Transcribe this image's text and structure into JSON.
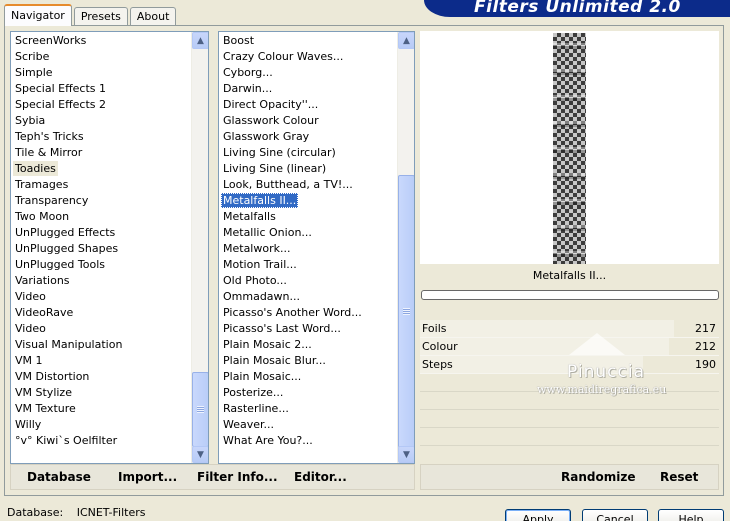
{
  "tabs": [
    {
      "label": "Navigator",
      "active": true
    },
    {
      "label": "Presets",
      "active": false
    },
    {
      "label": "About",
      "active": false
    }
  ],
  "app_title": "Filters Unlimited 2.0",
  "categories": {
    "items": [
      "ScreenWorks",
      "Scribe",
      "Simple",
      "Special Effects 1",
      "Special Effects 2",
      "Sybia",
      "Teph's Tricks",
      "Tile & Mirror",
      "Toadies",
      "Tramages",
      "Transparency",
      "Two Moon",
      "UnPlugged Effects",
      "UnPlugged Shapes",
      "UnPlugged Tools",
      "Variations",
      "Video",
      "VideoRave",
      "Video",
      "Visual Manipulation",
      "VM 1",
      "VM Distortion",
      "VM Stylize",
      "VM Texture",
      "Willy",
      "°v° Kiwi`s Oelfilter"
    ],
    "selected_index": 8,
    "scroll_position": 0.88
  },
  "filters": {
    "items": [
      "Boost",
      "Crazy Colour Waves...",
      "Cyborg...",
      "Darwin...",
      "Direct Opacity''...",
      "Glasswork Colour",
      "Glasswork Gray",
      "Living Sine (circular)",
      "Living Sine (linear)",
      "Look, Butthead, a TV!...",
      "Metalfalls II...",
      "Metalfalls",
      "Metallic Onion...",
      "Metalwork...",
      "Motion Trail...",
      "Old Photo...",
      "Ommadawn...",
      "Picasso's Another Word...",
      "Picasso's Last Word...",
      "Plain Mosaic 2...",
      "Plain Mosaic Blur...",
      "Plain Mosaic...",
      "Posterize...",
      "Rasterline...",
      "Weaver...",
      "What Are You?..."
    ],
    "selected_index": 10,
    "scroll_position": 1.0
  },
  "preview": {
    "filter_name": "Metalfalls II...",
    "progress": 0
  },
  "sliders": [
    {
      "label": "Foils",
      "value": "217",
      "max": 255
    },
    {
      "label": "Colour",
      "value": "212",
      "max": 255
    },
    {
      "label": "Steps",
      "value": "190",
      "max": 255
    }
  ],
  "watermark": {
    "name": "Pinuccia",
    "site": "www.maidiregrafica.eu"
  },
  "toolbar": {
    "database": "Database",
    "import": "Import...",
    "filter_info": "Filter Info...",
    "editor": "Editor...",
    "randomize": "Randomize",
    "reset": "Reset"
  },
  "status": {
    "label": "Database:",
    "value": "ICNET-Filters"
  },
  "dialog_buttons": {
    "apply": "Apply",
    "cancel": "Cancel",
    "help": "Help"
  },
  "colors": {
    "dialog_bg": "#ece9d8",
    "selection": "#316ac5",
    "banner": "#0c2b8a",
    "scrollbar": "#c3d3fd"
  },
  "icons": {
    "scroll_up": "chevron-up-icon",
    "scroll_down": "chevron-down-icon"
  }
}
